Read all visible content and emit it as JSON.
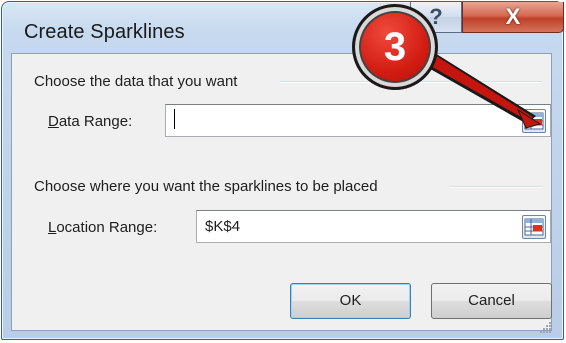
{
  "window": {
    "title": "Create Sparklines",
    "help_glyph": "?",
    "close_glyph": "X"
  },
  "data_group": {
    "heading": "Choose the data that you want",
    "label_mnemonic": "D",
    "label_rest": "ata Range:",
    "value": ""
  },
  "location_group": {
    "heading": "Choose where you want the sparklines to be placed",
    "label_mnemonic": "L",
    "label_rest": "ocation Range:",
    "value": "$K$4"
  },
  "buttons": {
    "ok": "OK",
    "cancel": "Cancel"
  },
  "callout": {
    "number": "3"
  },
  "colors": {
    "callout_red": "#d21c12",
    "close_red": "#c0402a",
    "title_bar": "#c6d9ef"
  },
  "icons": [
    "help-icon",
    "close-icon",
    "range-selector-icon",
    "resize-grip-icon"
  ]
}
